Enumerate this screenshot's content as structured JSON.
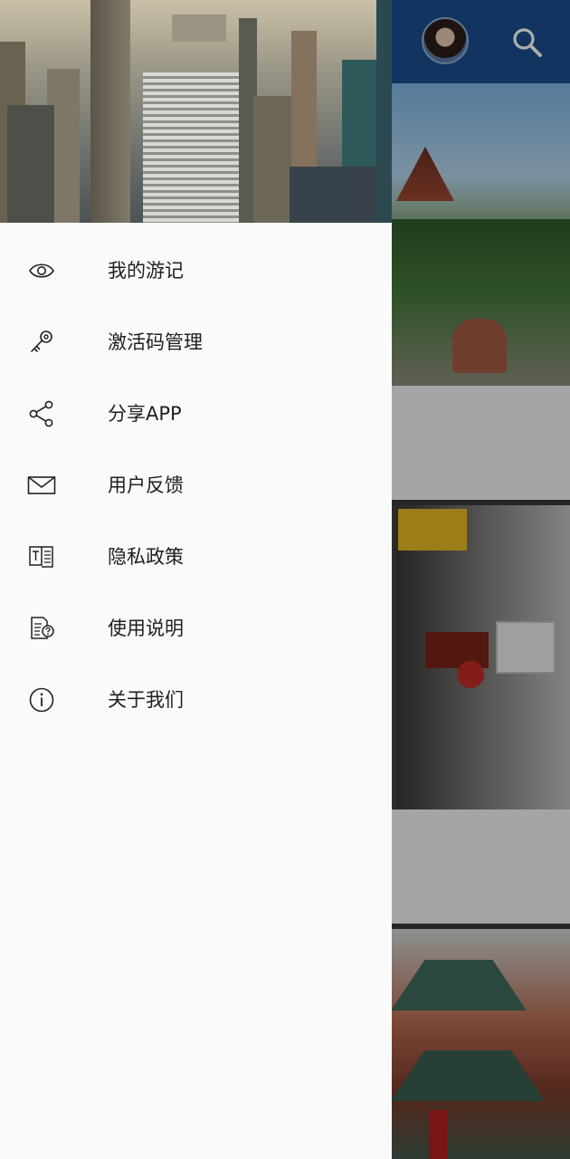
{
  "appbar": {
    "avatar_icon": "user-avatar",
    "search_icon": "search-icon",
    "color": "#1b4d8f"
  },
  "drawer": {
    "header_image": "city-skyline-photo",
    "menu": [
      {
        "label": "我的游记",
        "icon": "eye-icon"
      },
      {
        "label": "激活码管理",
        "icon": "key-icon"
      },
      {
        "label": "分享APP",
        "icon": "share-icon"
      },
      {
        "label": "用户反馈",
        "icon": "mail-icon"
      },
      {
        "label": "隐私政策",
        "icon": "document-icon"
      },
      {
        "label": "使用说明",
        "icon": "help-document-icon"
      },
      {
        "label": "关于我们",
        "icon": "info-icon"
      }
    ]
  },
  "feed": {
    "cards": [
      {
        "image": "pavilion-hill-photo"
      },
      {
        "image": "street-shops-photo"
      },
      {
        "image": "red-pavilion-photo"
      }
    ]
  }
}
